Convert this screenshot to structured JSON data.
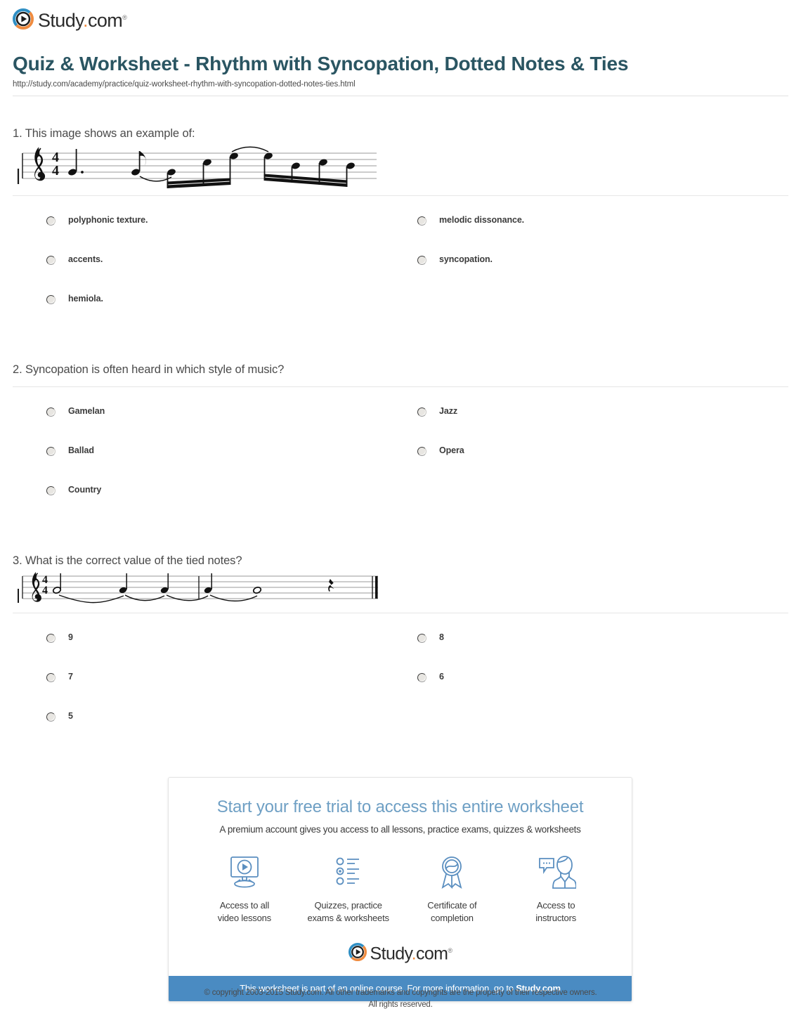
{
  "brand": {
    "name_main": "Study",
    "name_dot": ".",
    "name_tld": "com",
    "trademark": "®",
    "icon": "play-circle-icon",
    "orange": "#ef8b3f",
    "blue": "#2f8fc4"
  },
  "header": {
    "title": "Quiz & Worksheet - Rhythm with Syncopation, Dotted Notes & Ties",
    "url": "http://study.com/academy/practice/quiz-worksheet-rhythm-with-syncopation-dotted-notes-ties.html",
    "title_color": "#2a5562"
  },
  "questions": [
    {
      "number": "1.",
      "text": "1. This image shows an example of:",
      "has_staff": true,
      "staff_name": "music-staff-question-1",
      "options": [
        {
          "label": "polyphonic texture."
        },
        {
          "label": "melodic dissonance."
        },
        {
          "label": "accents."
        },
        {
          "label": "syncopation."
        },
        {
          "label": "hemiola."
        }
      ]
    },
    {
      "number": "2.",
      "text": "2. Syncopation is often heard in which style of music?",
      "has_staff": false,
      "staff_name": "",
      "options": [
        {
          "label": "Gamelan"
        },
        {
          "label": "Jazz"
        },
        {
          "label": "Ballad"
        },
        {
          "label": "Opera"
        },
        {
          "label": "Country"
        }
      ]
    },
    {
      "number": "3.",
      "text": "3. What is the correct value of the tied notes?",
      "has_staff": true,
      "staff_name": "music-staff-question-3",
      "options": [
        {
          "label": "9"
        },
        {
          "label": "8"
        },
        {
          "label": "7"
        },
        {
          "label": "6"
        },
        {
          "label": "5"
        }
      ]
    }
  ],
  "promo": {
    "title": "Start your free trial to access this entire worksheet",
    "subtitle": "A premium account gives you access to all lessons, practice exams, quizzes & worksheets",
    "features": [
      {
        "icon": "monitor-play-icon",
        "line1": "Access to all",
        "line2": "video lessons"
      },
      {
        "icon": "checklist-icon",
        "line1": "Quizzes, practice",
        "line2": "exams & worksheets"
      },
      {
        "icon": "award-ribbon-icon",
        "line1": "Certificate of",
        "line2": "completion"
      },
      {
        "icon": "instructor-chat-icon",
        "line1": "Access to",
        "line2": "instructors"
      }
    ],
    "banner_text": "This worksheet is part of an online course. For more information, go to ",
    "banner_link": "Study.com",
    "banner_color": "#4a8bc2"
  },
  "footer": {
    "line1": "© copyright 2003-2015 Study.com. All other trademarks and copyrights are the property of their respective owners.",
    "line2": "All rights reserved."
  }
}
